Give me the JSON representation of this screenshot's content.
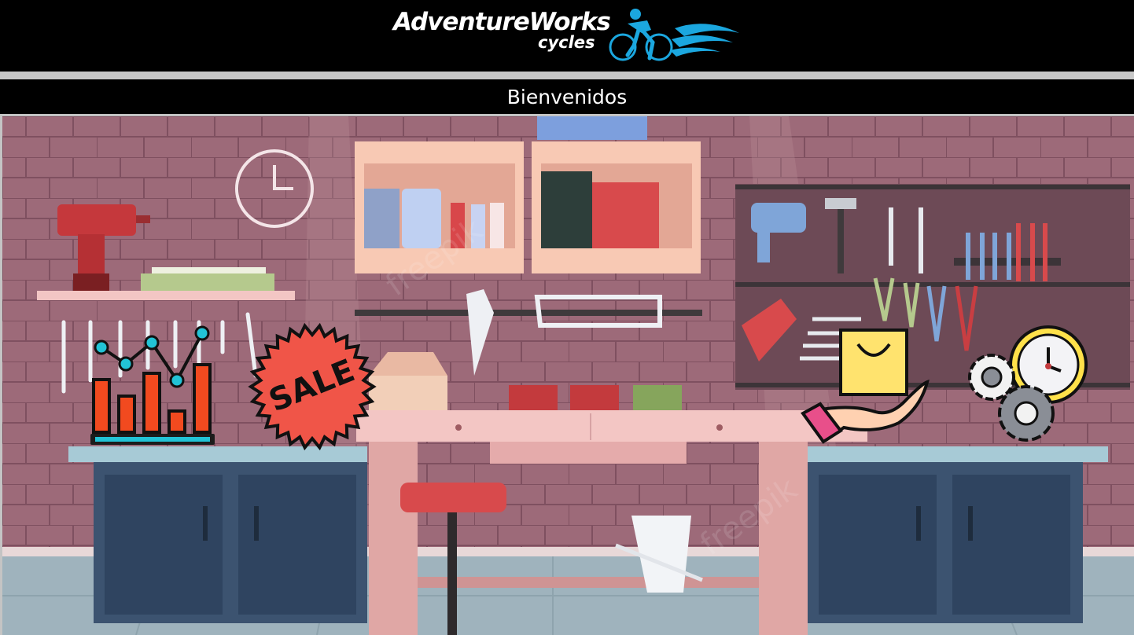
{
  "header": {
    "logo_brand": "AdventureWorks",
    "logo_sub": "cycles"
  },
  "welcome": {
    "text": "Bienvenidos"
  },
  "hero": {
    "sale_sticker_text": "SALE",
    "watermark_text": "freepik",
    "chart_bars": [
      0.7,
      0.48,
      0.78,
      0.28,
      0.9
    ],
    "icons": [
      "bar-chart-icon",
      "sale-badge-icon",
      "shopping-bag-hand-icon",
      "gears-clock-icon"
    ]
  },
  "colors": {
    "header_bg": "#000000",
    "separator": "#c8c8c8",
    "wall": "#9d6a79",
    "cabinet": "#3c5370",
    "countertop": "#a7cad6",
    "bench": "#e0a7a5",
    "logo_accent": "#1ba7df"
  }
}
